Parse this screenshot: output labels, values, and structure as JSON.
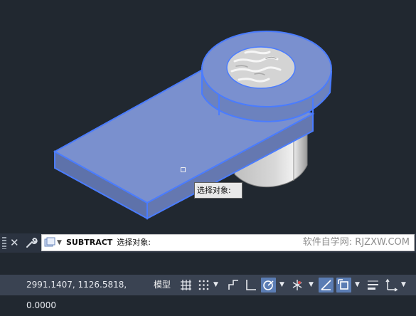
{
  "viewport": {
    "tooltip_text": "选择对象:"
  },
  "command_line": {
    "command": "SUBTRACT",
    "prompt": "选择对象:",
    "watermark": "软件自学网: RJZXW.COM"
  },
  "status_bar": {
    "coordinates": "2991.1407, 1126.5818, 0.0000",
    "model_label": "模型",
    "icons": [
      "grid-icon",
      "snap-icon",
      "infer-constraints-icon",
      "ortho-icon",
      "polar-tracking-icon",
      "isodraft-icon",
      "object-snap-tracking-icon",
      "object-snap-icon",
      "lineweight-icon",
      "ucs-icon"
    ]
  },
  "colors": {
    "background": "#212830",
    "selection_blue": "#4a7cff",
    "solid_face": "#6f86c4"
  }
}
